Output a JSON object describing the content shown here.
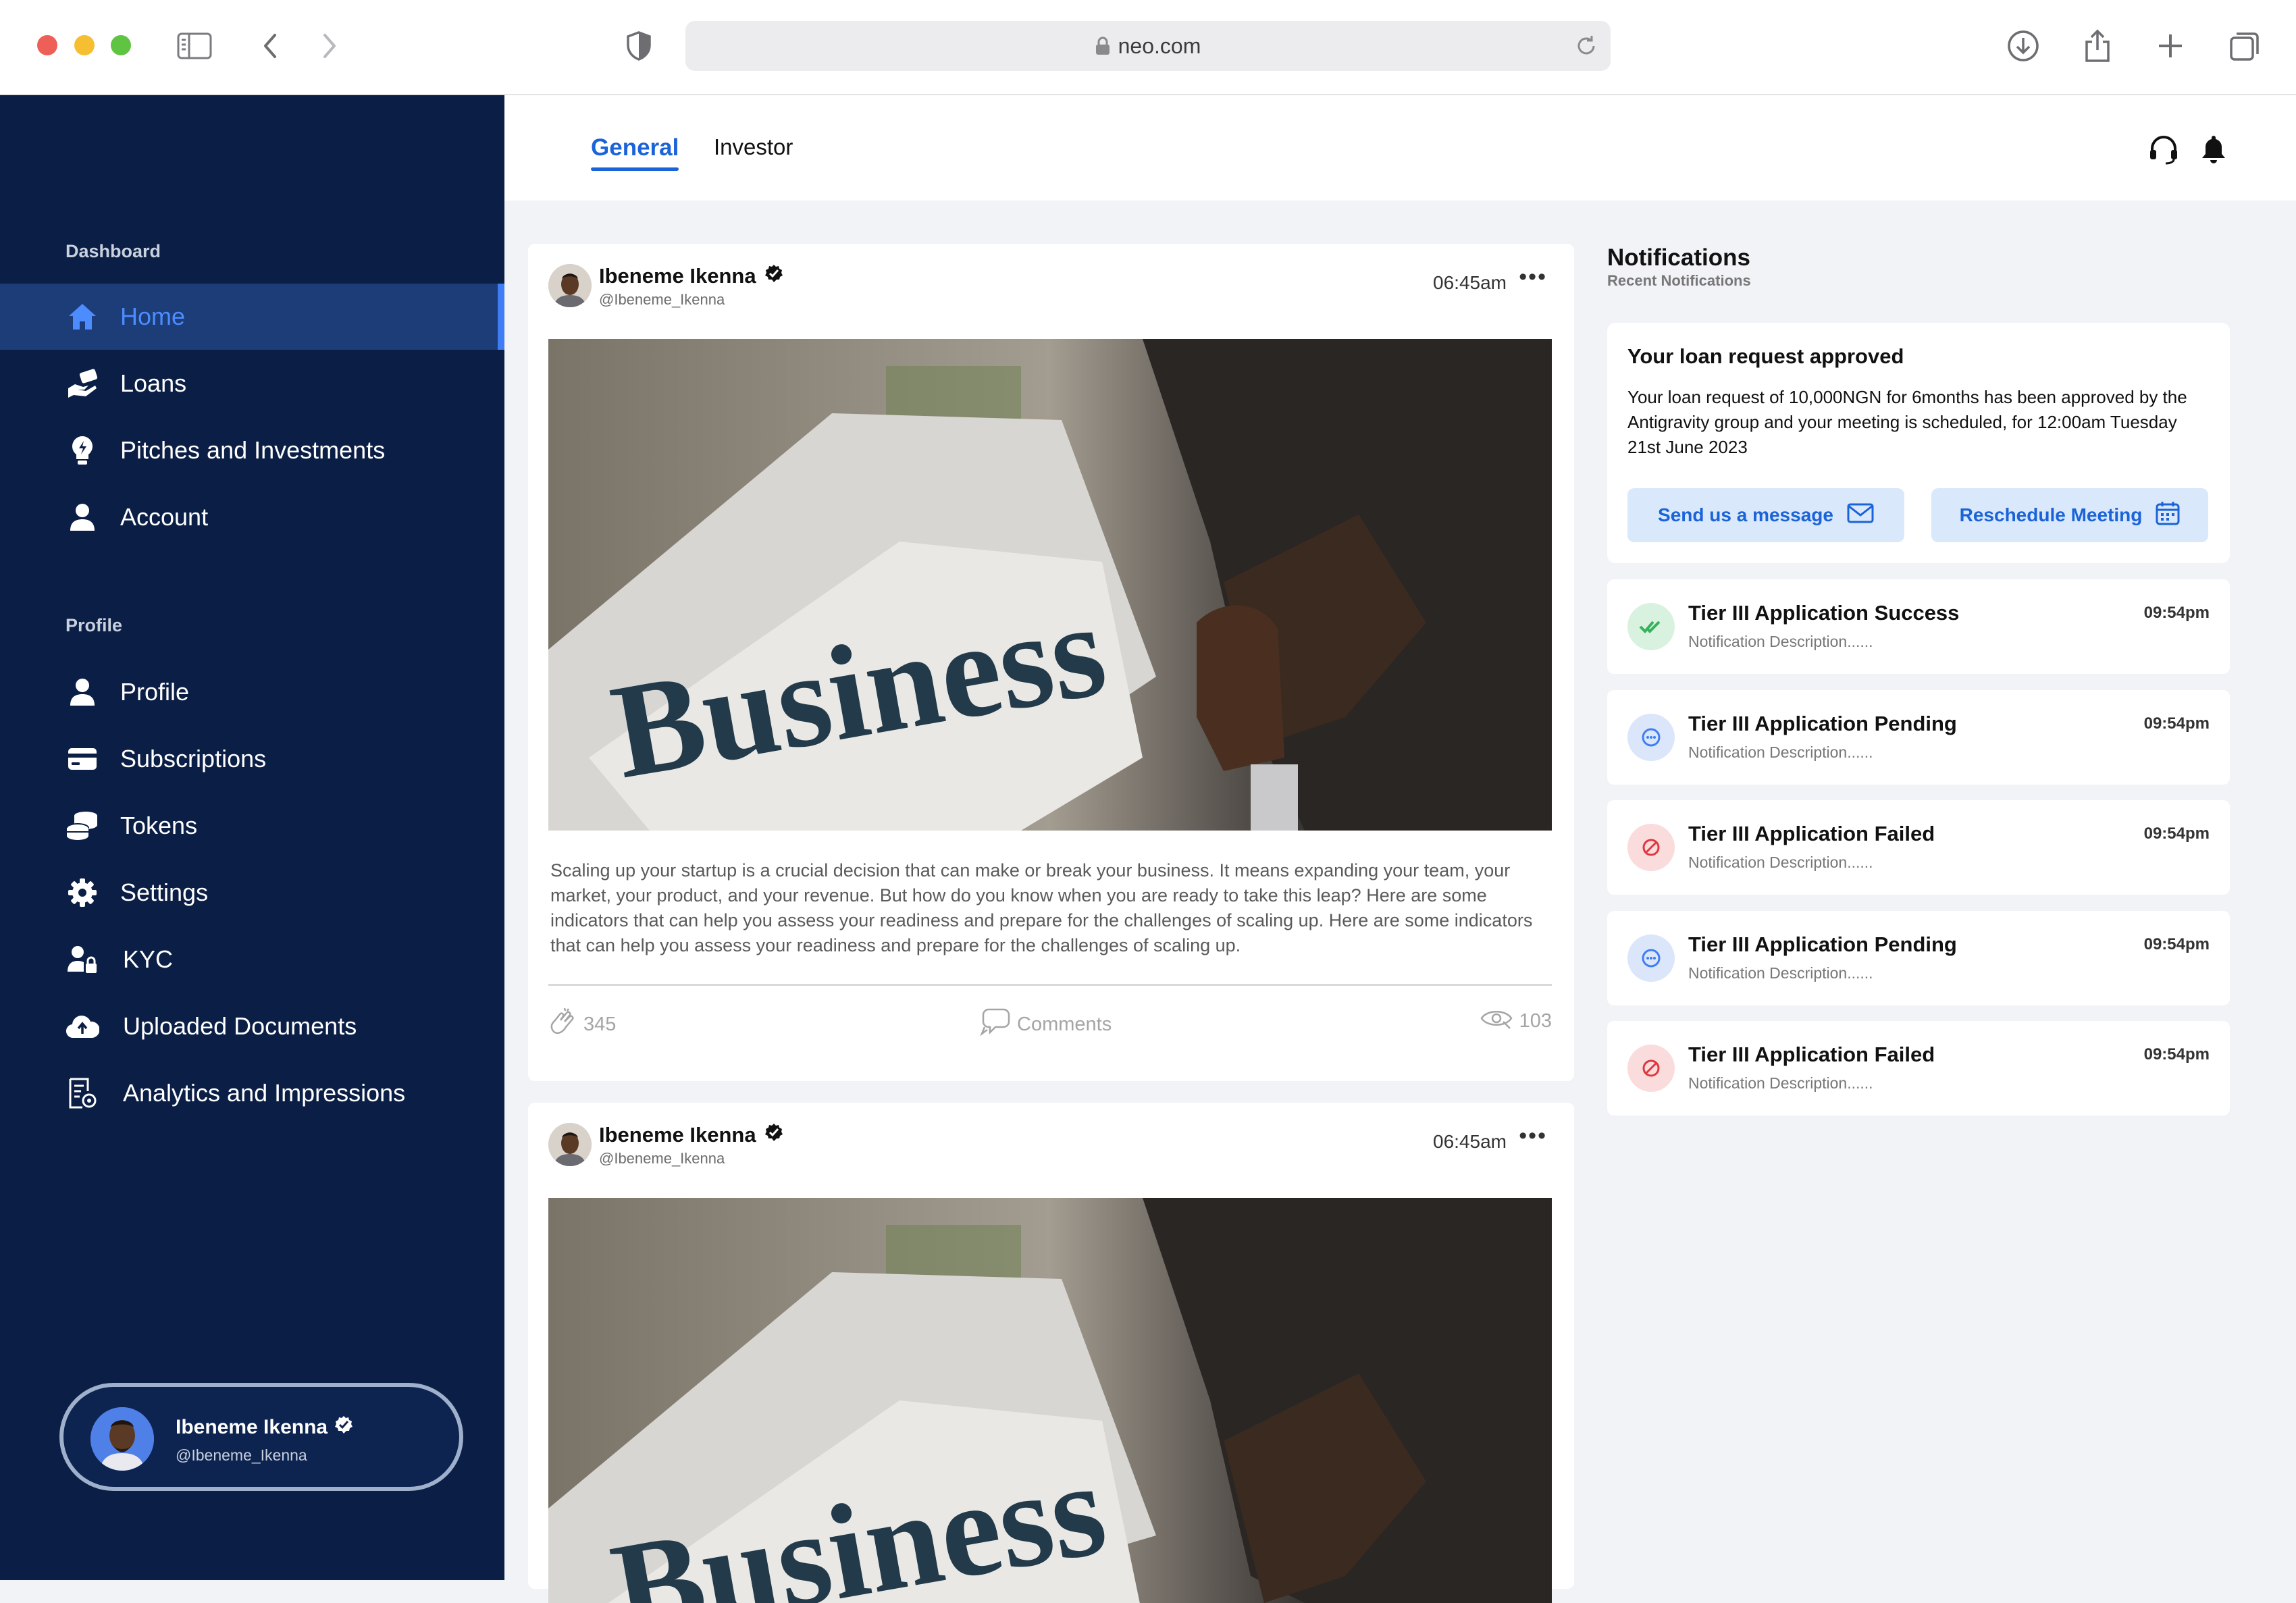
{
  "browser": {
    "url": "neo.com"
  },
  "sidebar": {
    "section_dashboard": "Dashboard",
    "section_profile": "Profile",
    "items": [
      {
        "label": "Home",
        "icon": "home-icon"
      },
      {
        "label": "Loans",
        "icon": "loans-icon"
      },
      {
        "label": "Pitches and Investments",
        "icon": "lightbulb-icon"
      },
      {
        "label": "Account",
        "icon": "user-icon"
      },
      {
        "label": "Profile",
        "icon": "user-icon"
      },
      {
        "label": "Subscriptions",
        "icon": "card-icon"
      },
      {
        "label": "Tokens",
        "icon": "coins-icon"
      },
      {
        "label": "Settings",
        "icon": "gear-icon"
      },
      {
        "label": "KYC",
        "icon": "user-lock-icon"
      },
      {
        "label": "Uploaded Documents",
        "icon": "cloud-upload-icon"
      },
      {
        "label": "Analytics and Impressions",
        "icon": "analytics-icon"
      }
    ],
    "user": {
      "name": "Ibeneme Ikenna",
      "handle": "@Ibeneme_Ikenna"
    }
  },
  "topbar": {
    "tabs": [
      "General",
      "Investor"
    ],
    "active_tab": "General"
  },
  "posts": [
    {
      "author": "Ibeneme Ikenna",
      "handle": "@Ibeneme_Ikenna",
      "time": "06:45am",
      "text": "Scaling up your startup is a crucial decision that can make or break your business. It means expanding your team, your market, your product, and your revenue. But how do you know when you are ready to take this leap? Here are some indicators that can help you assess your readiness and prepare for the challenges of scaling up. Here are some indicators that can help you assess your readiness and prepare for the challenges of scaling up.",
      "claps": "345",
      "comments_label": "Comments",
      "views": "103"
    },
    {
      "author": "Ibeneme Ikenna",
      "handle": "@Ibeneme_Ikenna",
      "time": "06:45am"
    }
  ],
  "notifications": {
    "title": "Notifications",
    "subtitle": "Recent Notifications",
    "loan": {
      "title": "Your loan request approved",
      "body": "Your loan request of 10,000NGN for 6months  has been approved by the Antigravity group and your meeting is scheduled, for 12:00am Tuesday 21st June 2023",
      "send_label": "Send us a message",
      "reschedule_label": "Reschedule Meeting"
    },
    "items": [
      {
        "title": "Tier III Application Success",
        "desc": "Notification Description......",
        "time": "09:54pm",
        "status": "success"
      },
      {
        "title": "Tier III Application Pending",
        "desc": "Notification Description......",
        "time": "09:54pm",
        "status": "pending"
      },
      {
        "title": "Tier III Application Failed",
        "desc": "Notification Description......",
        "time": "09:54pm",
        "status": "failed"
      },
      {
        "title": "Tier III Application Pending",
        "desc": "Notification Description......",
        "time": "09:54pm",
        "status": "pending"
      },
      {
        "title": "Tier III Application Failed",
        "desc": "Notification Description......",
        "time": "09:54pm",
        "status": "failed"
      }
    ]
  },
  "colors": {
    "sidebar_bg": "#0b1e45",
    "sidebar_active": "#1c3d78",
    "accent": "#1a63d8",
    "success": "#34b25b",
    "pending": "#3f7df4",
    "failed": "#e0383f"
  }
}
